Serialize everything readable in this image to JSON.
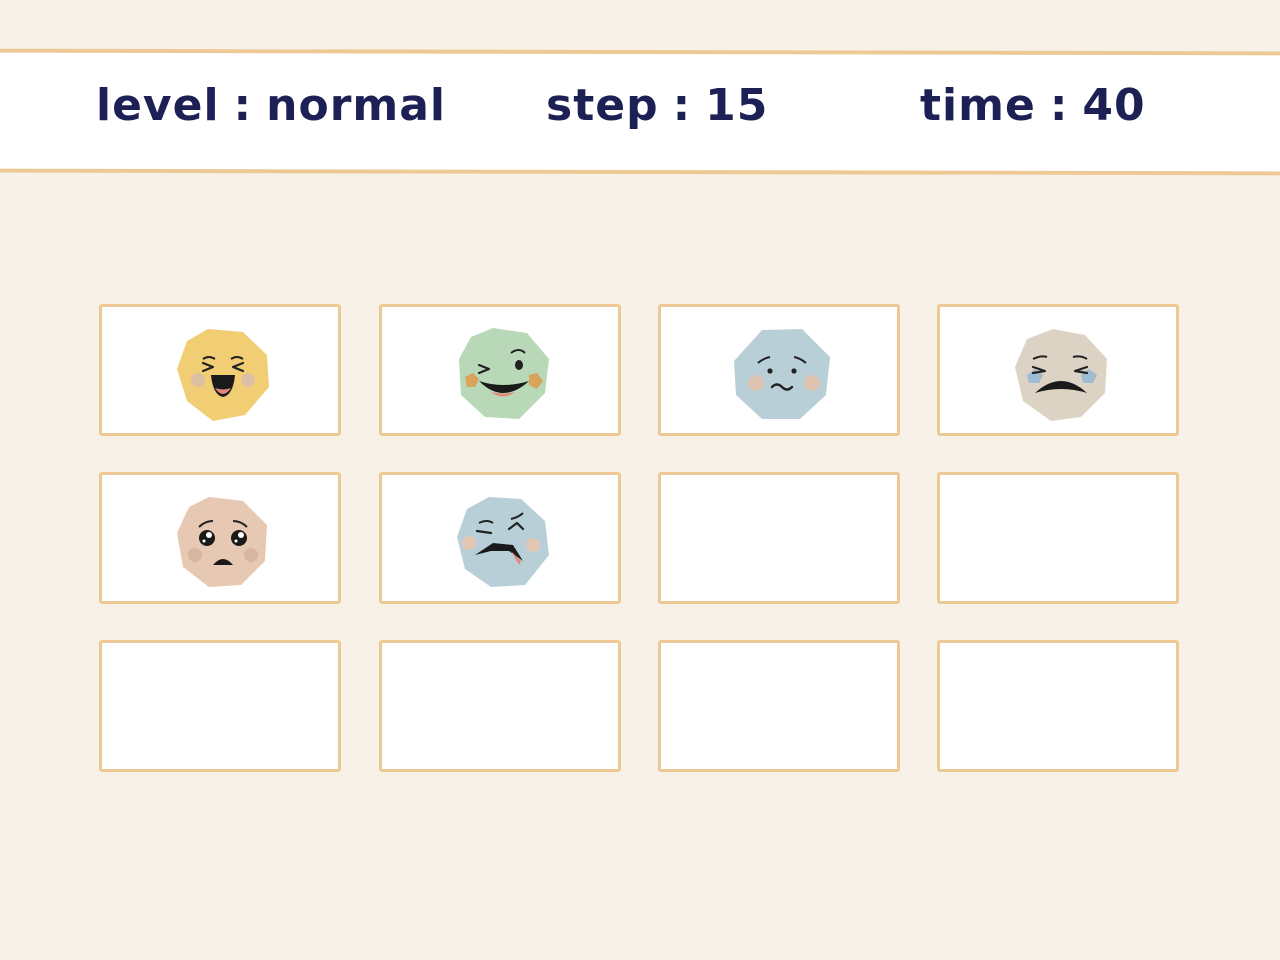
{
  "header": {
    "level": {
      "label": "level",
      "value": "normal"
    },
    "step": {
      "label": "step",
      "value": "15"
    },
    "time": {
      "label": "time",
      "value": "40"
    },
    "separator": ":"
  },
  "colors": {
    "background": "#f8f1e8",
    "card_border": "#ecc995",
    "text": "#1c2054",
    "face_yellow": "#f1ce74",
    "face_green": "#b8d8b8",
    "face_blue": "#b8cfd8",
    "face_beige": "#ddd3c4",
    "face_peach": "#e7c8b2"
  },
  "cards": [
    {
      "state": "revealed",
      "face": "laughing-face-icon"
    },
    {
      "state": "revealed",
      "face": "winking-face-icon"
    },
    {
      "state": "revealed",
      "face": "worried-face-icon"
    },
    {
      "state": "revealed",
      "face": "crying-face-icon"
    },
    {
      "state": "revealed",
      "face": "pleading-face-icon"
    },
    {
      "state": "revealed",
      "face": "grimacing-face-icon"
    },
    {
      "state": "hidden",
      "face": ""
    },
    {
      "state": "hidden",
      "face": ""
    },
    {
      "state": "hidden",
      "face": ""
    },
    {
      "state": "hidden",
      "face": ""
    },
    {
      "state": "hidden",
      "face": ""
    },
    {
      "state": "hidden",
      "face": ""
    }
  ]
}
